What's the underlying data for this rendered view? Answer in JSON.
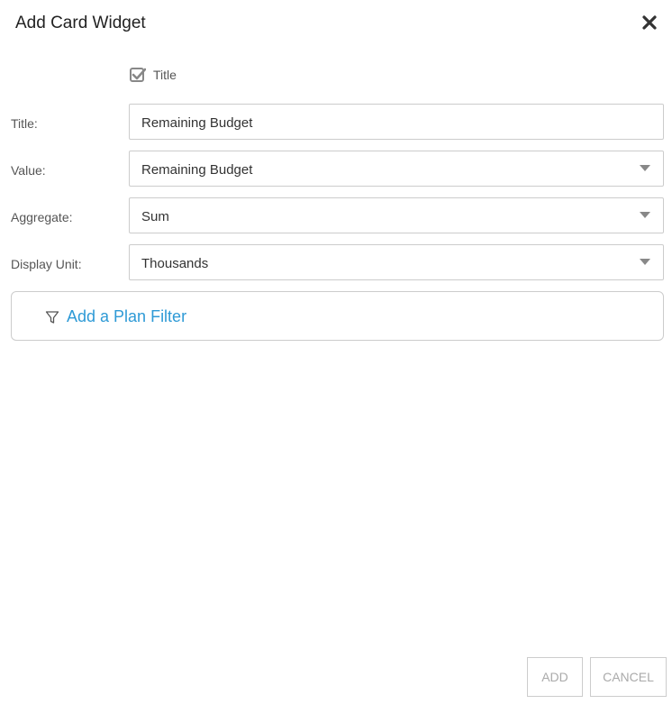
{
  "dialog": {
    "title": "Add Card Widget",
    "close_icon": "close-icon"
  },
  "show_title_checkbox": {
    "label": "Title",
    "checked": true
  },
  "fields": {
    "title": {
      "label": "Title:",
      "value": "Remaining Budget"
    },
    "value": {
      "label": "Value:",
      "selected": "Remaining Budget"
    },
    "aggregate": {
      "label": "Aggregate:",
      "selected": "Sum"
    },
    "display_unit": {
      "label": "Display Unit:",
      "selected": "Thousands"
    }
  },
  "filter": {
    "icon": "filter-icon",
    "link_label": "Add a Plan Filter",
    "link_color": "#2e9ad6"
  },
  "buttons": {
    "add_label": "ADD",
    "cancel_label": "CANCEL"
  }
}
